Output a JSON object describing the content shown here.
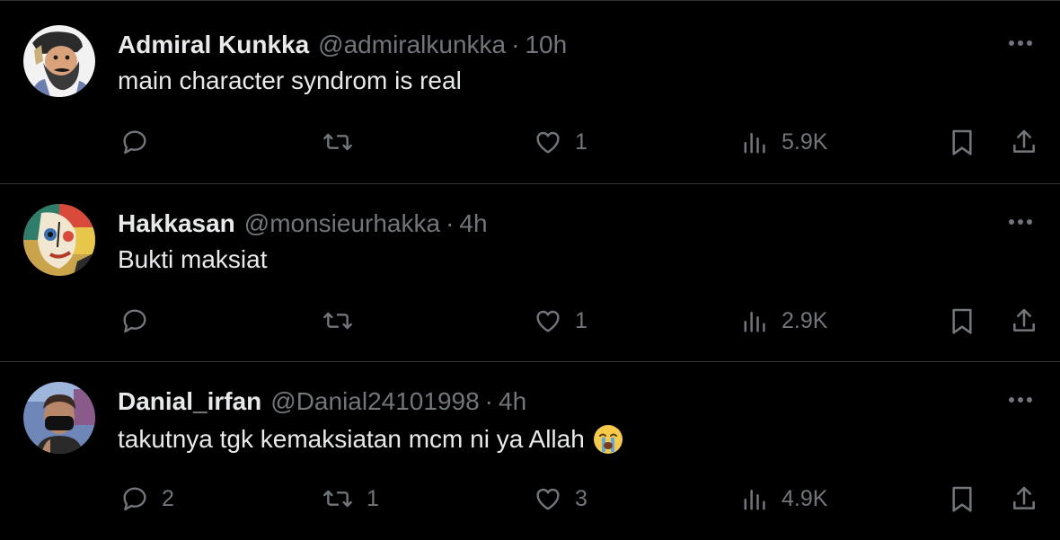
{
  "tweets": [
    {
      "name": "Admiral Kunkka",
      "handle": "@admiralkunkka",
      "separator": "·",
      "time": "10h",
      "text": "main character syndrom is real",
      "emoji": "",
      "replies": "",
      "retweets": "",
      "likes": "1",
      "views": "5.9K",
      "avatar": "bearded-pirate-cartoon"
    },
    {
      "name": "Hakkasan",
      "handle": "@monsieurhakka",
      "separator": "·",
      "time": "4h",
      "text": "Bukti maksiat",
      "emoji": "",
      "replies": "",
      "retweets": "",
      "likes": "1",
      "views": "2.9K",
      "avatar": "cubist-face-painting"
    },
    {
      "name": "Danial_irfan",
      "handle": "@Danial24101998",
      "separator": "·",
      "time": "4h",
      "text": "takutnya tgk kemaksiatan mcm ni ya Allah",
      "emoji": "😭",
      "replies": "2",
      "retweets": "1",
      "likes": "3",
      "views": "4.9K",
      "avatar": "man-with-black-mask-photo"
    }
  ],
  "colors": {
    "background": "#000000",
    "text": "#e7e9ea",
    "muted": "#71767b",
    "divider": "#2f3336"
  },
  "icons": [
    "reply-icon",
    "retweet-icon",
    "like-icon",
    "views-icon",
    "bookmark-icon",
    "share-icon",
    "more-icon"
  ]
}
